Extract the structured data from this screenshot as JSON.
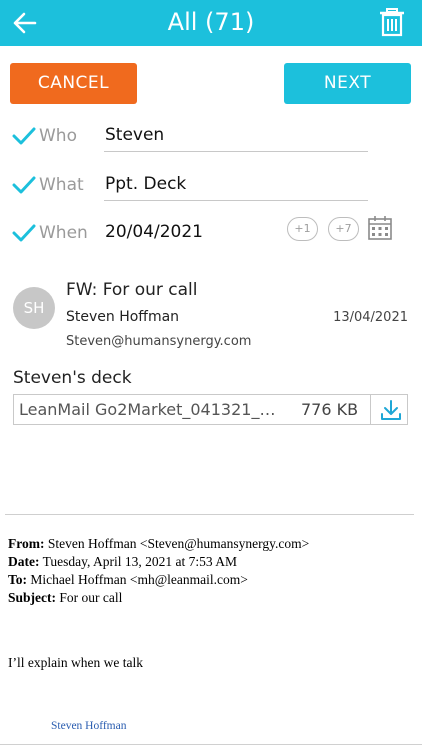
{
  "header": {
    "title": "All (71)",
    "accent": "#1cc0dc",
    "back_icon": "arrow-left-icon",
    "trash_icon": "trash-icon"
  },
  "actions": {
    "cancel_label": "CANCEL",
    "next_label": "NEXT",
    "cancel_color": "#f06a1e"
  },
  "fields": {
    "who": {
      "label": "Who",
      "value": "Steven"
    },
    "what": {
      "label": "What",
      "value": "Ppt. Deck"
    },
    "when": {
      "label": "When",
      "value": "20/04/2021",
      "plus1": "+1",
      "plus7": "+7"
    }
  },
  "message": {
    "avatar_initials": "SH",
    "subject": "FW: For our call",
    "sender": "Steven Hoffman",
    "date": "13/04/2021",
    "email": "Steven@humansynergy.com"
  },
  "attachment": {
    "section_label": "Steven's deck",
    "filename": "LeanMail Go2Market_041321_…",
    "size": "776 KB"
  },
  "email_body": {
    "from_label": "From:",
    "from_value": " Steven Hoffman <Steven@humansynergy.com>",
    "date_label": "Date:",
    "date_value": " Tuesday, April 13, 2021 at 7:53 AM",
    "to_label": "To:",
    "to_value": " Michael Hoffman <mh@leanmail.com>",
    "subject_label": "Subject:",
    "subject_value": " For our call",
    "text": "I’ll explain when we talk",
    "signature": "Steven Hoffman"
  }
}
